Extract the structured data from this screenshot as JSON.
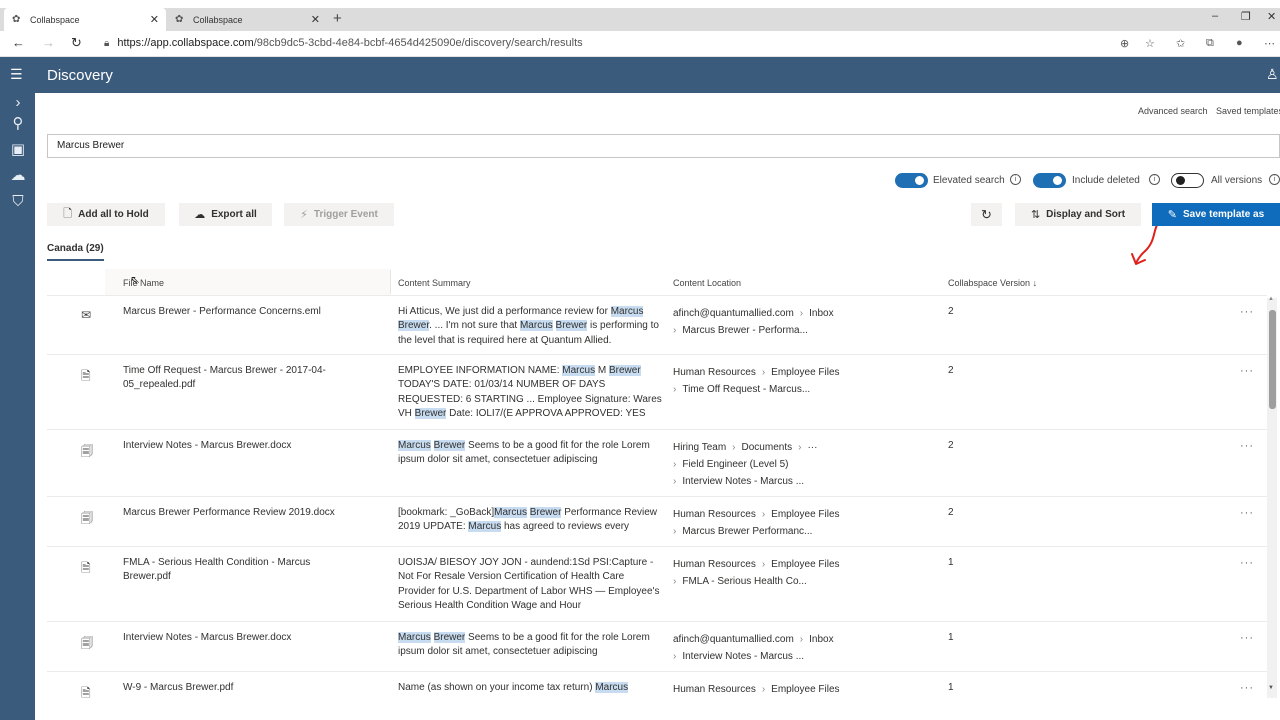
{
  "browser": {
    "tabs": [
      {
        "title": "Collabspace",
        "active": true
      },
      {
        "title": "Collabspace",
        "active": false
      }
    ],
    "url_host": "https://app.collabspace.com",
    "url_path": "/98cb9dc5-3cbd-4e84-bcbf-4654d425090e/discovery/search/results"
  },
  "app": {
    "title": "Discovery"
  },
  "links": {
    "advanced_search": "Advanced search",
    "saved_templates": "Saved templates"
  },
  "search": {
    "value": "Marcus Brewer"
  },
  "toggles": [
    {
      "label": "Elevated search",
      "on": true
    },
    {
      "label": "Include deleted",
      "on": true
    },
    {
      "label": "All versions",
      "on": false
    }
  ],
  "toolbar": {
    "add_all_to_hold": "Add all to Hold",
    "export_all": "Export all",
    "trigger_event": "Trigger Event",
    "display_and_sort": "Display and Sort",
    "save_template_as": "Save template as"
  },
  "group_tab": "Canada (29)",
  "columns": {
    "file_name": "File Name",
    "content_summary": "Content Summary",
    "content_location": "Content Location",
    "collabspace_version": "Collabspace Version",
    "sort_arrow": "↓"
  },
  "results": [
    {
      "icon": "email-icon",
      "file_name": "Marcus Brewer - Performance Concerns.eml",
      "summary": "Hi Atticus, We just did a performance review for <mark>Marcus</mark> <mark>Brewer</mark>. ... I'm not sure that <mark>Marcus</mark> <mark>Brewer</mark> is performing to the level that is required here at Quantum Allied.",
      "location": [
        [
          "afinch@quantumallied.com",
          "Inbox"
        ],
        [
          "Marcus Brewer - Performa..."
        ]
      ],
      "version": "2"
    },
    {
      "icon": "pdf-icon",
      "file_name": "Time Off Request - Marcus Brewer - 2017-04-05_repealed.pdf",
      "summary": "EMPLOYEE INFORMATION NAME: <mark>Marcus</mark> M <mark>Brewer</mark> TODAY'S DATE: 01/03/14 NUMBER OF DAYS REQUESTED: 6 STARTING ... Employee Signature: Wares VH <mark>Brewer</mark> Date: IOLI7/(E APPROVA APPROVED: YES",
      "location": [
        [
          "Human Resources",
          "Employee Files"
        ],
        [
          "Time Off Request - Marcus..."
        ]
      ],
      "version": "2"
    },
    {
      "icon": "word-doc-icon",
      "file_name": "Interview Notes - Marcus Brewer.docx",
      "summary": "<mark>Marcus</mark> <mark>Brewer</mark> Seems to be a good fit for the role Lorem ipsum dolor sit amet, consectetuer adipiscing",
      "location": [
        [
          "Hiring Team",
          "Documents",
          "···"
        ],
        [
          "Field Engineer (Level 5)"
        ],
        [
          "Interview Notes - Marcus ..."
        ]
      ],
      "version": "2"
    },
    {
      "icon": "word-doc-icon",
      "file_name": "Marcus Brewer Performance Review 2019.docx",
      "summary": "[bookmark: _GoBack]<mark>Marcus</mark> <mark>Brewer</mark> Performance Review 2019 UPDATE: <mark>Marcus</mark> has agreed to reviews every",
      "location": [
        [
          "Human Resources",
          "Employee Files"
        ],
        [
          "Marcus Brewer Performanc..."
        ]
      ],
      "version": "2"
    },
    {
      "icon": "pdf-icon",
      "file_name": "FMLA - Serious Health Condition - Marcus Brewer.pdf",
      "summary": "UOISJA/ BIESOY JOY JON - aundend:1Sd PSI:Capture - Not For Resale Version Certification of Health Care Provider for U.S. Department of Labor WHS — Employee's Serious Health Condition Wage and Hour",
      "location": [
        [
          "Human Resources",
          "Employee Files"
        ],
        [
          "FMLA - Serious Health Co..."
        ]
      ],
      "version": "1"
    },
    {
      "icon": "word-doc-icon",
      "file_name": "Interview Notes - Marcus Brewer.docx",
      "summary": "<mark>Marcus</mark> <mark>Brewer</mark> Seems to be a good fit for the role Lorem ipsum dolor sit amet, consectetuer adipiscing",
      "location": [
        [
          "afinch@quantumallied.com",
          "Inbox"
        ],
        [
          "Interview Notes - Marcus ..."
        ]
      ],
      "version": "1"
    },
    {
      "icon": "pdf-icon",
      "file_name": "W-9 - Marcus Brewer.pdf",
      "summary": "Name (as shown on your income tax return) <mark>Marcus</mark>",
      "location": [
        [
          "Human Resources",
          "Employee Files"
        ]
      ],
      "version": "1"
    }
  ],
  "colors": {
    "header": "#3b5b7c",
    "primary_button": "#0f6cbd",
    "toggle_on": "#1f6fb5",
    "highlight": "#c7dcf0",
    "annotation": "#e0201b"
  }
}
